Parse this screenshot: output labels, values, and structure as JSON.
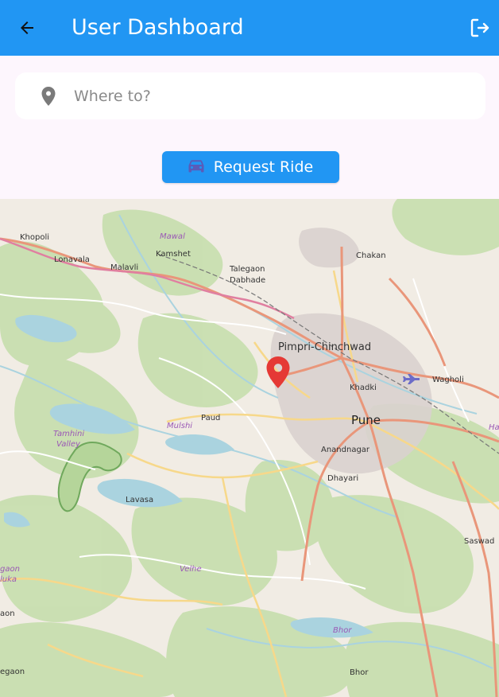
{
  "appbar": {
    "title": "User Dashboard",
    "back_icon": "arrow-back-icon",
    "logout_icon": "logout-icon",
    "color": "#2196f3"
  },
  "search": {
    "placeholder": "Where to?",
    "value": "",
    "icon": "location-pin-icon"
  },
  "request_button": {
    "label": "Request Ride",
    "icon": "car-icon"
  },
  "map": {
    "marker_icon": "map-marker-icon",
    "marker_color": "#e53935",
    "labels": {
      "khopoli": "Khopoli",
      "mawal": "Mawal",
      "lonavala": "Lonavala",
      "malavli": "Malavli",
      "kamshet": "Kamshet",
      "talegaon": "Talegaon",
      "dabhade": "Dabhade",
      "chakan": "Chakan",
      "pimpri": "Pimpri-Chinchwad",
      "khadki": "Khadki",
      "wagholi": "Wagholi",
      "paud": "Paud",
      "mulshi": "Mulshi",
      "pune": "Pune",
      "tamhini": "Tamhini",
      "valley": "Valley",
      "anandnagar": "Anandnagar",
      "dhayari": "Dhayari",
      "lavasa": "Lavasa",
      "saswad": "Saswad",
      "gaon": "gaon",
      "luka": "luka",
      "velhe": "Velhe",
      "aon": "aon",
      "bhor_it": "Bhor",
      "egaon": "egaon",
      "bhor": "Bhor",
      "ha": "Ha"
    }
  }
}
